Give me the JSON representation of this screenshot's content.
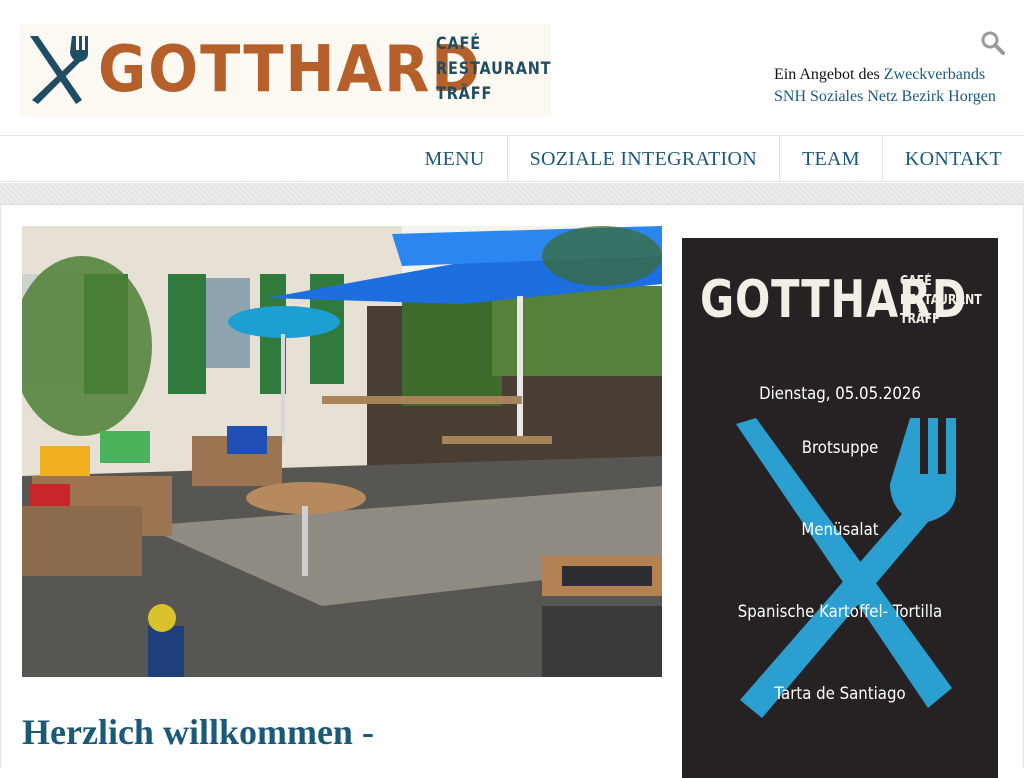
{
  "header": {
    "logo": {
      "wordmark": "GOTTHARD",
      "sub_lines": [
        "CAFÉ",
        "RESTAURANT",
        "TRÄFF"
      ]
    },
    "provider": {
      "prefix": "Ein Angebot des ",
      "link_1": "Zweckverbands",
      "link_2": "SNH Soziales Netz Bezirk Horgen"
    }
  },
  "nav": {
    "items": [
      "MENU",
      "SOZIALE INTEGRATION",
      "TEAM",
      "KONTAKT"
    ]
  },
  "main": {
    "welcome": "Herzlich willkommen -"
  },
  "poster": {
    "wordmark": "GOTTHARD",
    "sub_lines": [
      "CAFÉ",
      "RESTAURANT",
      "TRÄFF"
    ],
    "date": "Dienstag, 05.05.2026",
    "dishes": [
      "Brotsuppe",
      "Menüsalat",
      "Spanische Kartoffel- Tortilla",
      "Tarta de Santiago"
    ]
  },
  "colors": {
    "brand_orange": "#b5602a",
    "brand_blue": "#1a5a78",
    "poster_bg": "#262223",
    "poster_cutlery": "#2a9fd0"
  },
  "icons": {
    "search": "search-icon",
    "cutlery": "fork-knife-icon"
  }
}
